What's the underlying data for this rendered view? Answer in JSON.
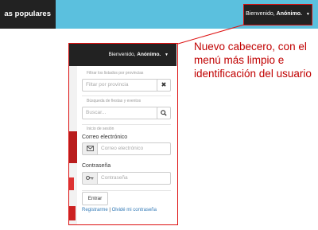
{
  "navbar": {
    "left_text": "as populares",
    "user_greeting": "Bienvenido,",
    "user_name": "Anónimo."
  },
  "annotation": {
    "text": "Nuevo cabecero, con el menú más limpio e identificación del usuario"
  },
  "dropdown": {
    "greeting": "Bienvenido,",
    "user_name": "Anónimo.",
    "filter_section_label": "Filtrar los listados por provincias",
    "filter_placeholder": "Filtar por provincia",
    "search_section_label": "Búsqueda de fiestas y eventos",
    "search_placeholder": "Buscar...",
    "login_section_label": "Inicio de sesión",
    "email_label": "Correo electrónico",
    "email_placeholder": "Correo electrónico",
    "password_label": "Contraseña",
    "password_placeholder": "Contraseña",
    "submit_label": "Entrar",
    "register_link": "Registrarme",
    "link_separator": "|",
    "forgot_link": "Olvidé mi contraseña"
  },
  "colors": {
    "navbar_bg": "#5bc0de",
    "dark_bg": "#222222",
    "annotation_red": "#c00000",
    "link_blue": "#337ab7"
  }
}
